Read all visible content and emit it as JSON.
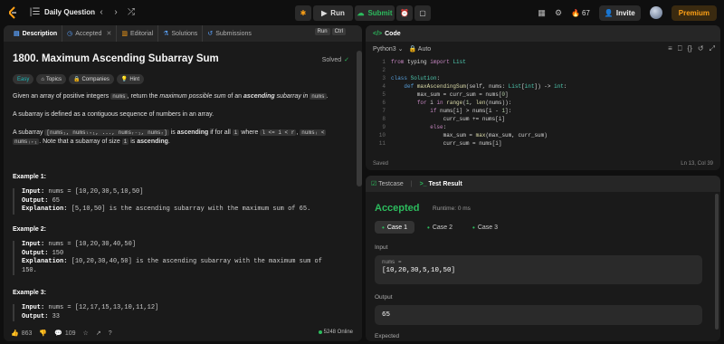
{
  "topbar": {
    "title": "Daily Question",
    "run_label": "Run",
    "submit_label": "Submit",
    "streak": "67",
    "invite_label": "Invite",
    "premium_label": "Premium"
  },
  "left": {
    "tabs": [
      "Description",
      "Accepted",
      "Editorial",
      "Solutions",
      "Submissions"
    ],
    "run_kbd": [
      "Run",
      "Ctrl"
    ],
    "title": "1800. Maximum Ascending Subarray Sum",
    "solved": "Solved",
    "pills": [
      "Easy",
      "Topics",
      "Companies",
      "Hint"
    ],
    "desc": {
      "p1_a": "Given an array of positive integers",
      "p1_code": "nums",
      "p1_b": ", return the",
      "p1_c": "maximum possible sum",
      "p1_d": "of an",
      "p1_e": "ascending",
      "p1_f": "subarray in",
      "p1_g": "nums",
      "p1_h": ".",
      "p2": "A subarray is defined as a contiguous sequence of numbers in an array.",
      "p3_a": "A subarray",
      "p3_code1": "[nums₁, numsₗ₊₁, ..., numsᵣ₋₁, numsᵣ]",
      "p3_b": "is",
      "p3_c": "ascending",
      "p3_d": "if for all",
      "p3_code2": "i",
      "p3_e": "where",
      "p3_code3": "l <= i < r",
      "p3_f": ",",
      "p3_code4": "numsᵢ <",
      "p3_code5": "numsᵢ₊₁",
      "p3_g": ". Note that a subarray of size",
      "p3_code6": "1",
      "p3_h": "is",
      "p3_i": "ascending",
      "p3_j": "."
    },
    "examples": [
      {
        "title": "Example 1:",
        "input": "nums = [10,20,30,5,10,50]",
        "output": "65",
        "explanation": "[5,10,50] is the ascending subarray with the maximum sum of 65."
      },
      {
        "title": "Example 2:",
        "input": "nums = [10,20,30,40,50]",
        "output": "150",
        "explanation": "[10,20,30,40,50] is the ascending subarray with the maximum sum of",
        "explanation2": "150."
      },
      {
        "title": "Example 3:",
        "input": "nums = [12,17,15,13,10,11,12]",
        "output": "33"
      }
    ],
    "labels": {
      "input": "Input:",
      "output": "Output:",
      "explanation": "Explanation:"
    },
    "footer": {
      "likes": "863",
      "comments": "109",
      "online": "5248 Online"
    }
  },
  "code": {
    "header": "Code",
    "language": "Python3",
    "auto": "Auto",
    "line_numbers": [
      "1",
      "2",
      "3",
      "4",
      "5",
      "6",
      "7",
      "8",
      "9",
      "10",
      "11"
    ],
    "status_left": "Saved",
    "status_right": "Ln 13, Col 39"
  },
  "result": {
    "tabs": [
      "Testcase",
      "Test Result"
    ],
    "status": "Accepted",
    "runtime": "Runtime: 0 ms",
    "cases": [
      "Case 1",
      "Case 2",
      "Case 3"
    ],
    "input_label": "Input",
    "input_name": "nums =",
    "input_value": "[10,20,30,5,10,50]",
    "output_label": "Output",
    "output_value": "65",
    "expected_label": "Expected"
  },
  "colors": {
    "accent_green": "#2cbb5d",
    "premium": "#ffa116",
    "easy": "#1cbaba"
  }
}
